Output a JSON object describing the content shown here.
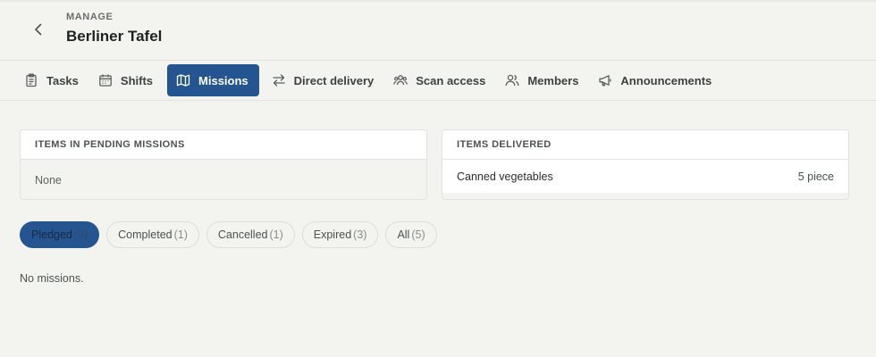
{
  "header": {
    "eyebrow": "MANAGE",
    "title": "Berliner Tafel"
  },
  "tabs": [
    {
      "label": "Tasks",
      "icon": "clipboard-icon",
      "active": false
    },
    {
      "label": "Shifts",
      "icon": "calendar-icon",
      "active": false
    },
    {
      "label": "Missions",
      "icon": "map-icon",
      "active": true
    },
    {
      "label": "Direct delivery",
      "icon": "swap-arrows-icon",
      "active": false
    },
    {
      "label": "Scan access",
      "icon": "group-icon",
      "active": false
    },
    {
      "label": "Members",
      "icon": "users-icon",
      "active": false
    },
    {
      "label": "Announcements",
      "icon": "megaphone-icon",
      "active": false
    }
  ],
  "pending_card": {
    "title": "ITEMS IN PENDING MISSIONS",
    "empty_text": "None"
  },
  "delivered_card": {
    "title": "ITEMS DELIVERED",
    "items": [
      {
        "name": "Canned vegetables",
        "quantity": "5 piece"
      }
    ]
  },
  "filters": [
    {
      "label": "Pledged",
      "count": "(0)",
      "active": true
    },
    {
      "label": "Completed",
      "count": "(1)",
      "active": false
    },
    {
      "label": "Cancelled",
      "count": "(1)",
      "active": false
    },
    {
      "label": "Expired",
      "count": "(3)",
      "active": false
    },
    {
      "label": "All",
      "count": "(5)",
      "active": false
    }
  ],
  "empty_state": "No missions.",
  "colors": {
    "accent": "#255590",
    "background": "#f3f4f0"
  }
}
